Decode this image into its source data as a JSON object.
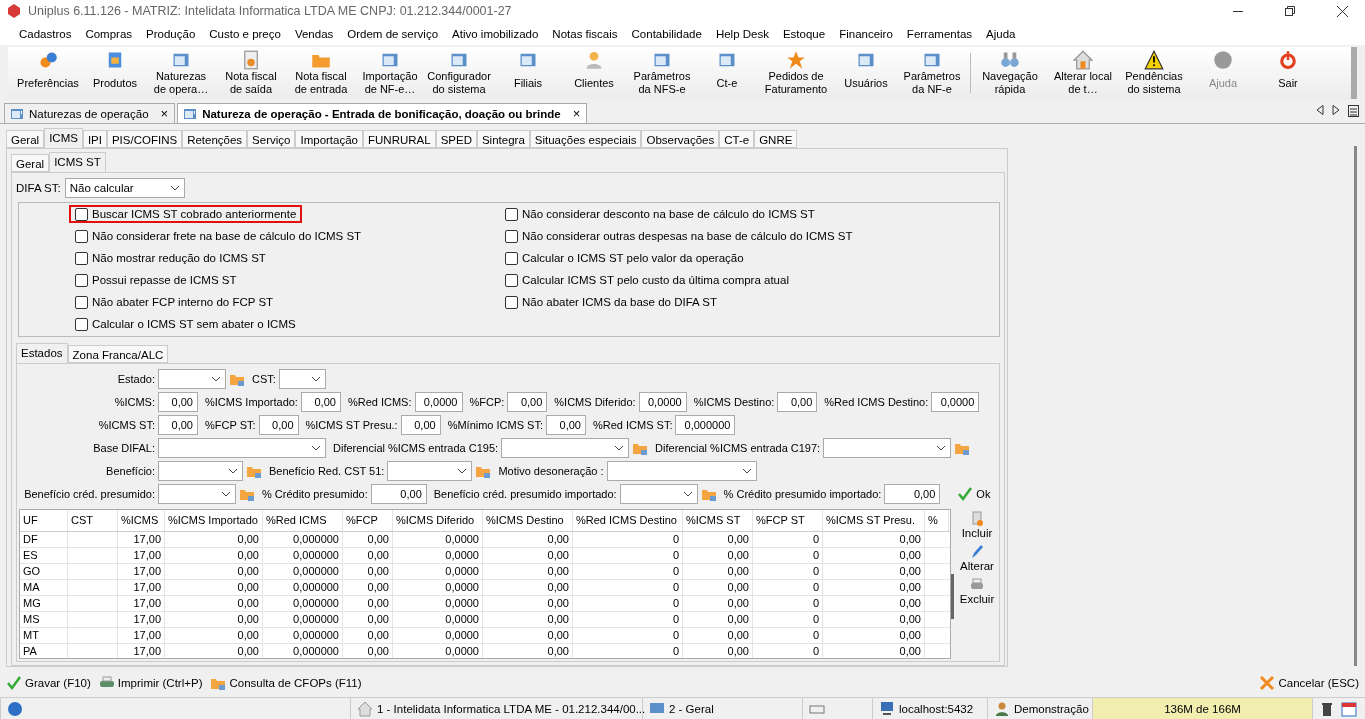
{
  "window": {
    "title": "Uniplus 6.11.126 - MATRIZ: Intelidata Informatica LTDA ME CNPJ: 01.212.344/0001-27"
  },
  "menu": [
    "Cadastros",
    "Compras",
    "Produção",
    "Custo e preço",
    "Vendas",
    "Ordem de serviço",
    "Ativo imobilizado",
    "Notas fiscais",
    "Contabilidade",
    "Help Desk",
    "Estoque",
    "Financeiro",
    "Ferramentas",
    "Ajuda"
  ],
  "toolbar": [
    {
      "label": "Preferências",
      "disabled": false
    },
    {
      "label": "Produtos",
      "disabled": false
    },
    {
      "label": "Naturezas\nde opera…",
      "disabled": false
    },
    {
      "label": "Nota fiscal\nde saída",
      "disabled": false
    },
    {
      "label": "Nota fiscal\nde entrada",
      "disabled": false
    },
    {
      "label": "Importação\nde NF-e…",
      "disabled": false
    },
    {
      "label": "Configurador\ndo sistema",
      "disabled": false
    },
    {
      "label": "Filiais",
      "disabled": false
    },
    {
      "label": "Clientes",
      "disabled": false
    },
    {
      "label": "Parâmetros\nda NFS-e",
      "disabled": false
    },
    {
      "label": "Ct-e",
      "disabled": false
    },
    {
      "label": "Pedidos de\nFaturamento",
      "disabled": false
    },
    {
      "label": "Usuários",
      "disabled": false
    },
    {
      "label": "Parâmetros\nda NF-e",
      "disabled": false
    },
    {
      "label": "Navegação\nrápida",
      "disabled": false
    },
    {
      "label": "Alterar local\nde t…",
      "disabled": false
    },
    {
      "label": "Pendências\ndo sistema",
      "disabled": false
    },
    {
      "label": "Ajuda",
      "disabled": true
    },
    {
      "label": "Sair",
      "disabled": false
    }
  ],
  "doc_tabs": [
    {
      "label": "Naturezas de operação",
      "close": "×",
      "selected": false
    },
    {
      "label": "Natureza de operação - Entrada de bonificação, doação ou brinde",
      "close": "×",
      "selected": true
    }
  ],
  "tabs": [
    {
      "label": "Geral",
      "selected": false
    },
    {
      "label": "ICMS",
      "selected": true
    },
    {
      "label": "IPI",
      "selected": false
    },
    {
      "label": "PIS/COFINS",
      "selected": false
    },
    {
      "label": "Retenções",
      "selected": false
    },
    {
      "label": "Serviço",
      "selected": false
    },
    {
      "label": "Importação",
      "selected": false
    },
    {
      "label": "FUNRURAL",
      "selected": false
    },
    {
      "label": "SPED",
      "selected": false
    },
    {
      "label": "Sintegra",
      "selected": false
    },
    {
      "label": "Situações especiais",
      "selected": false
    },
    {
      "label": "Observações",
      "selected": false
    },
    {
      "label": "CT-e",
      "selected": false
    },
    {
      "label": "GNRE",
      "selected": false
    }
  ],
  "sub_tabs": [
    {
      "label": "Geral",
      "selected": false
    },
    {
      "label": "ICMS ST",
      "selected": true
    }
  ],
  "difa_st": {
    "label": "DIFA ST:",
    "value": "Não calcular"
  },
  "options_left": [
    {
      "label": "Buscar ICMS ST cobrado anteriormente",
      "checked": false,
      "highlighted": true
    },
    {
      "label": "Não considerar frete na base de cálculo do ICMS ST",
      "checked": false,
      "highlighted": false
    },
    {
      "label": "Não mostrar redução do ICMS ST",
      "checked": false,
      "highlighted": false
    },
    {
      "label": "Possui repasse de ICMS ST",
      "checked": false,
      "highlighted": false
    },
    {
      "label": "Não abater FCP interno do FCP ST",
      "checked": false,
      "highlighted": false
    },
    {
      "label": "Calcular o ICMS ST sem abater o ICMS",
      "checked": false,
      "highlighted": false
    }
  ],
  "options_right": [
    {
      "label": "Não considerar desconto na base de cálculo do ICMS ST",
      "checked": false,
      "highlighted": false
    },
    {
      "label": "Não considerar outras despesas na base de cálculo do ICMS ST",
      "checked": false,
      "highlighted": false
    },
    {
      "label": "Calcular o ICMS ST pelo valor da operação",
      "checked": false,
      "highlighted": false
    },
    {
      "label": "Calcular ICMS ST pelo custo da última compra atual",
      "checked": false,
      "highlighted": false
    },
    {
      "label": "Não abater ICMS da base do DIFA ST",
      "checked": false,
      "highlighted": false
    }
  ],
  "state_tabs": [
    {
      "label": "Estados",
      "selected": true
    },
    {
      "label": "Zona Franca/ALC",
      "selected": false
    }
  ],
  "form_rows": [
    [
      {
        "kind": "select",
        "label": "Estado:",
        "lookup": true
      },
      {
        "kind": "select",
        "label": "CST:",
        "lookup": false
      }
    ],
    [
      {
        "kind": "input",
        "label": "%ICMS:",
        "value": "0,00"
      },
      {
        "kind": "input",
        "label": "%ICMS Importado:",
        "value": "0,00"
      },
      {
        "kind": "input",
        "label": "%Red ICMS:",
        "value": "0,0000"
      },
      {
        "kind": "input",
        "label": "%FCP:",
        "value": "0,00"
      },
      {
        "kind": "input",
        "label": "%ICMS Diferido:",
        "value": "0,0000"
      },
      {
        "kind": "input",
        "label": "%ICMS Destino:",
        "value": "0,00"
      },
      {
        "kind": "input",
        "label": "%Red ICMS Destino:",
        "value": "0,0000"
      }
    ],
    [
      {
        "kind": "input",
        "label": "%ICMS ST:",
        "value": "0,00"
      },
      {
        "kind": "input",
        "label": "%FCP ST:",
        "value": "0,00"
      },
      {
        "kind": "input",
        "label": "%ICMS ST Presu.:",
        "value": "0,00"
      },
      {
        "kind": "input",
        "label": "%Mínimo ICMS ST:",
        "value": "0,00"
      },
      {
        "kind": "input",
        "label": "%Red ICMS ST:",
        "value": "0,000000"
      }
    ],
    [
      {
        "kind": "select",
        "label": "Base DIFAL:",
        "lookup": false
      },
      {
        "kind": "select",
        "label": "Diferencial %ICMS entrada C195:",
        "lookup": true
      },
      {
        "kind": "select",
        "label": "Diferencial %ICMS entrada C197:",
        "lookup": true
      }
    ],
    [
      {
        "kind": "select",
        "label": "Benefício:",
        "lookup": true
      },
      {
        "kind": "select",
        "label": "Benefício Red. CST 51:",
        "lookup": true
      },
      {
        "kind": "select",
        "label": "Motivo desoneração :",
        "lookup": false
      }
    ],
    [
      {
        "kind": "select",
        "label": "Benefício créd. presumido:",
        "lookup": true
      },
      {
        "kind": "input",
        "label": "% Crédito presumido:",
        "value": "0,00"
      },
      {
        "kind": "select",
        "label": "Benefício créd. presumido importado:",
        "lookup": true
      },
      {
        "kind": "input",
        "label": "% Crédito presumido importado:",
        "value": "0,00"
      },
      {
        "kind": "button",
        "label": "Ok"
      }
    ]
  ],
  "table": {
    "columns": [
      "UF",
      "CST",
      "%ICMS",
      "%ICMS Importado",
      "%Red ICMS",
      "%FCP",
      "%ICMS Diferido",
      "%ICMS Destino",
      "%Red ICMS Destino",
      "%ICMS ST",
      "%FCP ST",
      "%ICMS ST Presu.",
      "%"
    ],
    "rows": [
      [
        "DF",
        "",
        "17,00",
        "0,00",
        "0,000000",
        "0,00",
        "0,0000",
        "0,00",
        "0",
        "0,00",
        "0",
        "0,00"
      ],
      [
        "ES",
        "",
        "17,00",
        "0,00",
        "0,000000",
        "0,00",
        "0,0000",
        "0,00",
        "0",
        "0,00",
        "0",
        "0,00"
      ],
      [
        "GO",
        "",
        "17,00",
        "0,00",
        "0,000000",
        "0,00",
        "0,0000",
        "0,00",
        "0",
        "0,00",
        "0",
        "0,00"
      ],
      [
        "MA",
        "",
        "17,00",
        "0,00",
        "0,000000",
        "0,00",
        "0,0000",
        "0,00",
        "0",
        "0,00",
        "0",
        "0,00"
      ],
      [
        "MG",
        "",
        "17,00",
        "0,00",
        "0,000000",
        "0,00",
        "0,0000",
        "0,00",
        "0",
        "0,00",
        "0",
        "0,00"
      ],
      [
        "MS",
        "",
        "17,00",
        "0,00",
        "0,000000",
        "0,00",
        "0,0000",
        "0,00",
        "0",
        "0,00",
        "0",
        "0,00"
      ],
      [
        "MT",
        "",
        "17,00",
        "0,00",
        "0,000000",
        "0,00",
        "0,0000",
        "0,00",
        "0",
        "0,00",
        "0",
        "0,00"
      ],
      [
        "PA",
        "",
        "17,00",
        "0,00",
        "0,000000",
        "0,00",
        "0,0000",
        "0,00",
        "0",
        "0,00",
        "0",
        "0,00"
      ]
    ]
  },
  "table_actions": [
    "Incluir",
    "Alterar",
    "Excluir"
  ],
  "footer_actions": [
    "Gravar (F10)",
    "Imprimir (Ctrl+P)",
    "Consulta de CFOPs (F11)"
  ],
  "cancel": "Cancelar (ESC)",
  "status_bar": {
    "company": "1 - Intelidata Informatica LTDA ME - 01.212.344/00...",
    "branch": "2 - Geral",
    "server": "localhost:5432",
    "user": "Demonstração",
    "memory": "136M de 166M"
  }
}
